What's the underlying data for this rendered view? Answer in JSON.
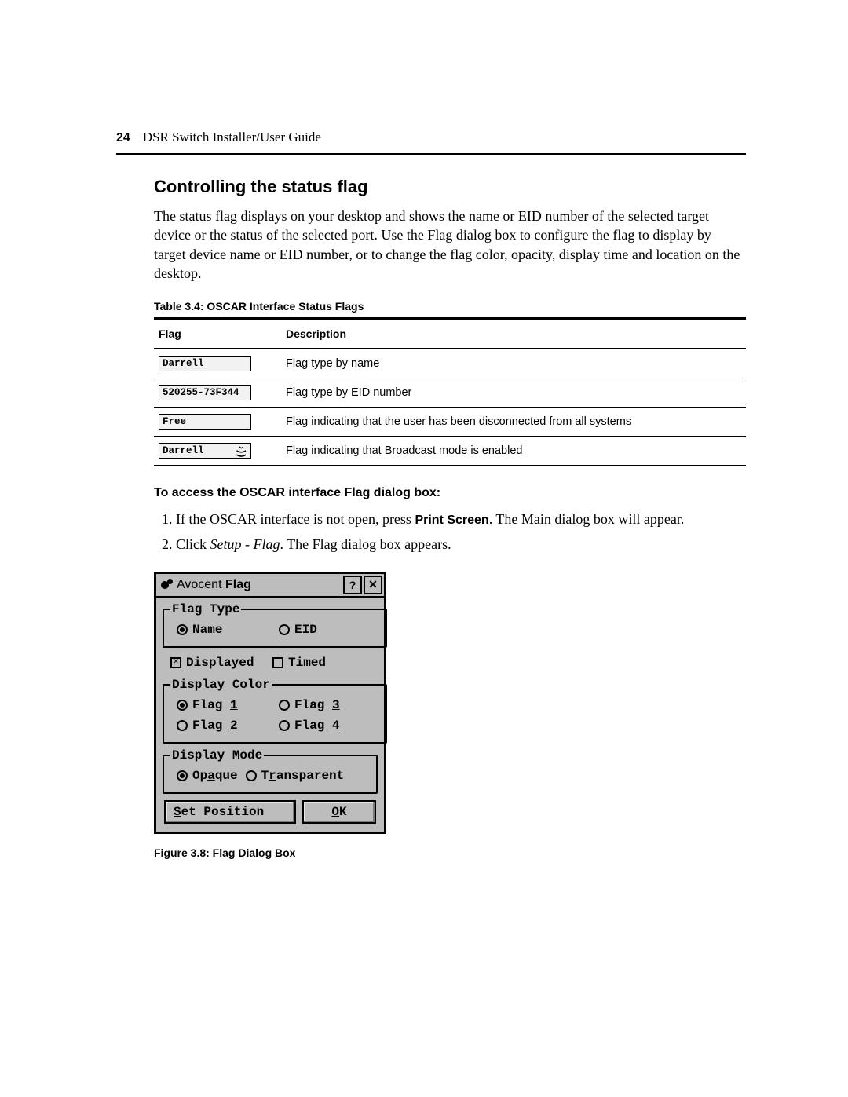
{
  "header": {
    "page_number": "24",
    "guide_title": "DSR Switch Installer/User Guide"
  },
  "section_heading": "Controlling the status flag",
  "intro_paragraph": "The status flag displays on your desktop and shows the name or EID number of the selected target device or the status of the selected port. Use the Flag dialog box to configure the flag to display by target device name or EID number, or to change the flag color, opacity, display time and location on the desktop.",
  "table": {
    "caption": "Table 3.4: OSCAR Interface Status Flags",
    "head": {
      "col1": "Flag",
      "col2": "Description"
    },
    "rows": [
      {
        "flag_label": "Darrell",
        "has_icon": false,
        "desc": "Flag type by name"
      },
      {
        "flag_label": "520255-73F344",
        "has_icon": false,
        "desc": "Flag type by EID number"
      },
      {
        "flag_label": "Free",
        "has_icon": false,
        "desc": "Flag indicating that the user has been disconnected from all systems"
      },
      {
        "flag_label": "Darrell",
        "has_icon": true,
        "desc": "Flag indicating that Broadcast mode is enabled"
      }
    ]
  },
  "subheading": "To access the OSCAR interface Flag dialog box:",
  "steps": [
    {
      "pre": "If the OSCAR interface is not open, press ",
      "kw": "Print Screen",
      "post": ". The Main dialog box will appear."
    },
    {
      "pre": "Click ",
      "ital": "Setup - Flag",
      "post": ". The Flag dialog box appears."
    }
  ],
  "dialog": {
    "brand_thin": "Avocent",
    "title": "Flag",
    "flag_type": {
      "legend": "Flag Type",
      "name_label_u": "N",
      "name_label_rest": "ame",
      "eid_label_u": "E",
      "eid_label_rest": "ID"
    },
    "disp_row": {
      "displayed_u": "D",
      "displayed_rest": "isplayed",
      "timed_u": "T",
      "timed_rest": "imed"
    },
    "display_color": {
      "legend": "Display Color",
      "f1_pre": "Flag ",
      "f1_u": "1",
      "f2_pre": "Flag ",
      "f2_u": "2",
      "f3_pre": "Flag ",
      "f3_u": "3",
      "f4_pre": "Flag ",
      "f4_u": "4"
    },
    "display_mode": {
      "legend": "Display Mode",
      "opa_pre": "Op",
      "opa_u": "a",
      "opa_post": "que",
      "tr_pre": "T",
      "tr_u": "r",
      "tr_post": "ansparent"
    },
    "set_pos_u": "S",
    "set_pos_rest": "et Position",
    "ok_u": "O",
    "ok_rest": "K"
  },
  "figure_caption": "Figure 3.8: Flag Dialog Box"
}
